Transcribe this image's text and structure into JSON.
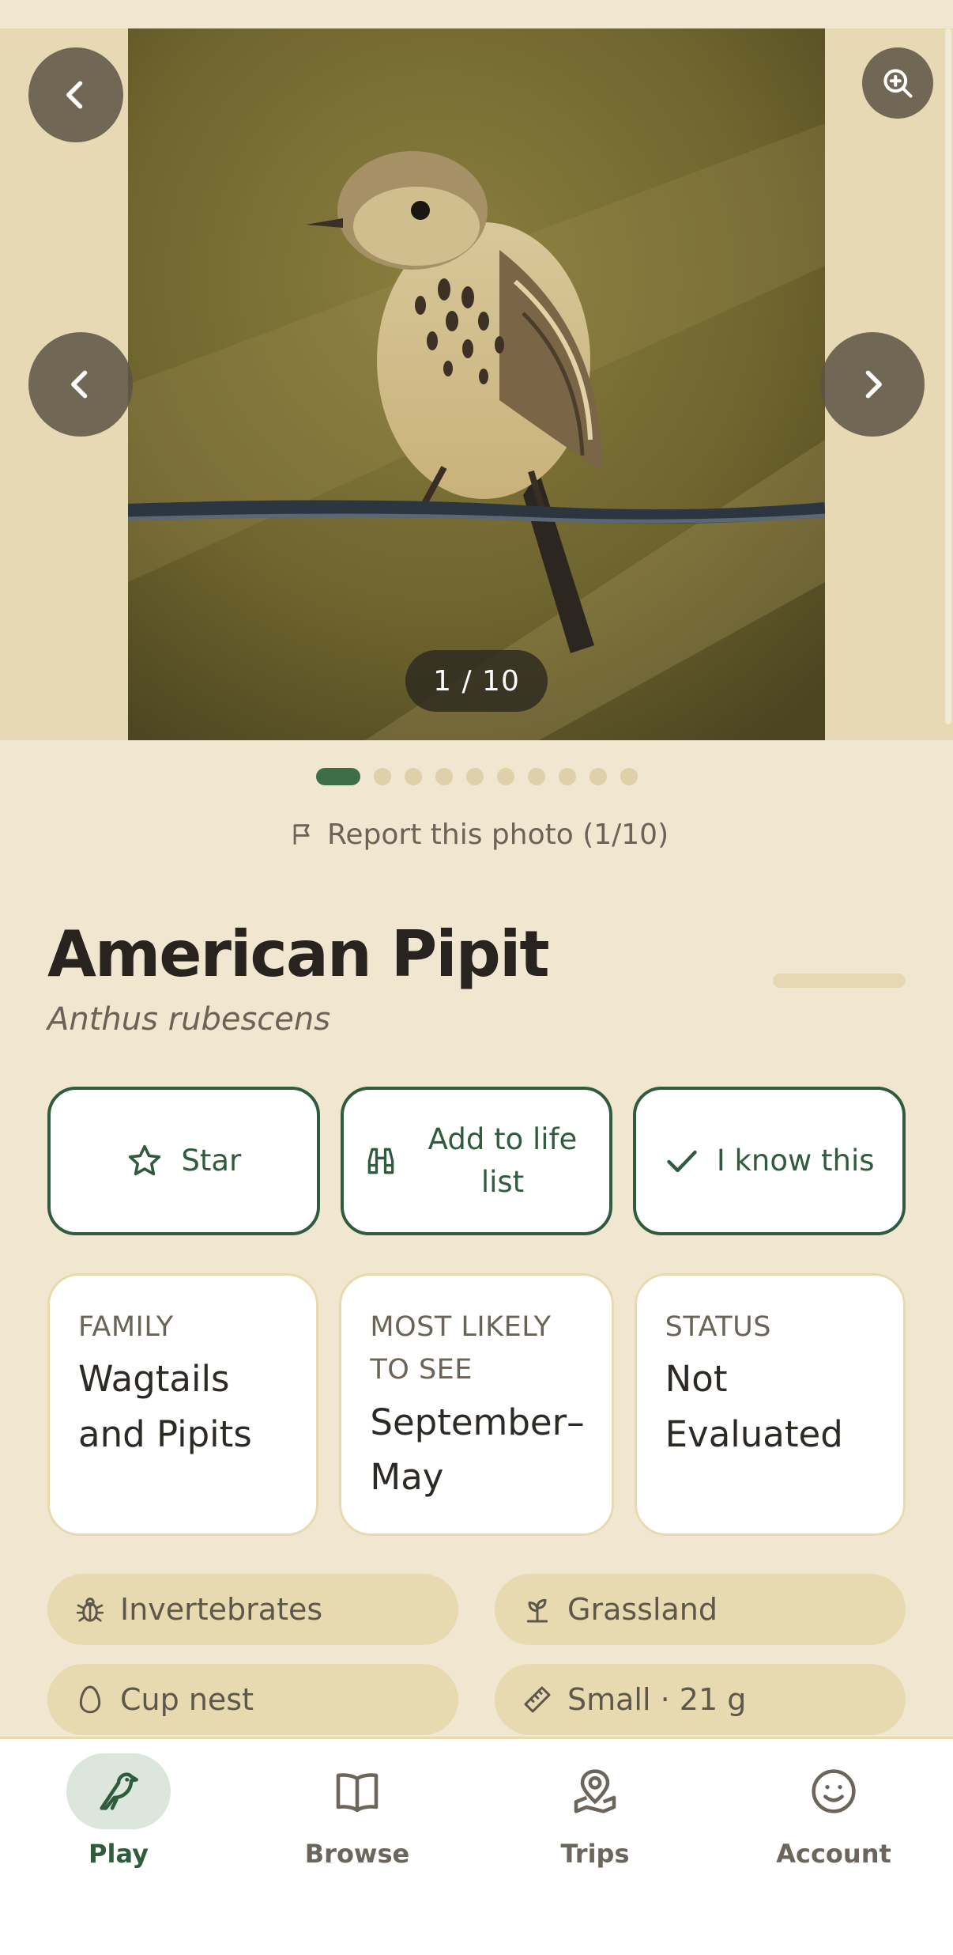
{
  "gallery": {
    "counter": "1 / 10",
    "current": 1,
    "total": 10,
    "report_label": "Report this photo (1/10)"
  },
  "species": {
    "common_name": "American Pipit",
    "scientific_name": "Anthus rubescens"
  },
  "actions": [
    {
      "label": "Star",
      "icon": "star-icon"
    },
    {
      "label": "Add to life list",
      "icon": "binoculars-icon"
    },
    {
      "label": "I know this",
      "icon": "check-icon"
    }
  ],
  "facts": [
    {
      "label": "FAMILY",
      "value": "Wagtails and Pipits"
    },
    {
      "label": "MOST LIKELY TO SEE",
      "value": "September–May"
    },
    {
      "label": "STATUS",
      "value": "Not Evaluated"
    }
  ],
  "tags": [
    {
      "label": "Invertebrates",
      "icon": "bug-icon"
    },
    {
      "label": "Grassland",
      "icon": "sprout-icon"
    },
    {
      "label": "Cup nest",
      "icon": "egg-icon"
    },
    {
      "label": "Small · 21 g",
      "icon": "ruler-icon"
    }
  ],
  "nav": [
    {
      "label": "Play",
      "icon": "bird-icon",
      "active": true
    },
    {
      "label": "Browse",
      "icon": "book-icon",
      "active": false
    },
    {
      "label": "Trips",
      "icon": "map-pin-icon",
      "active": false
    },
    {
      "label": "Account",
      "icon": "smiley-icon",
      "active": false
    }
  ],
  "colors": {
    "background": "#f1e6cf",
    "accent": "#2f5c3c",
    "tag": "#e8dab0"
  }
}
